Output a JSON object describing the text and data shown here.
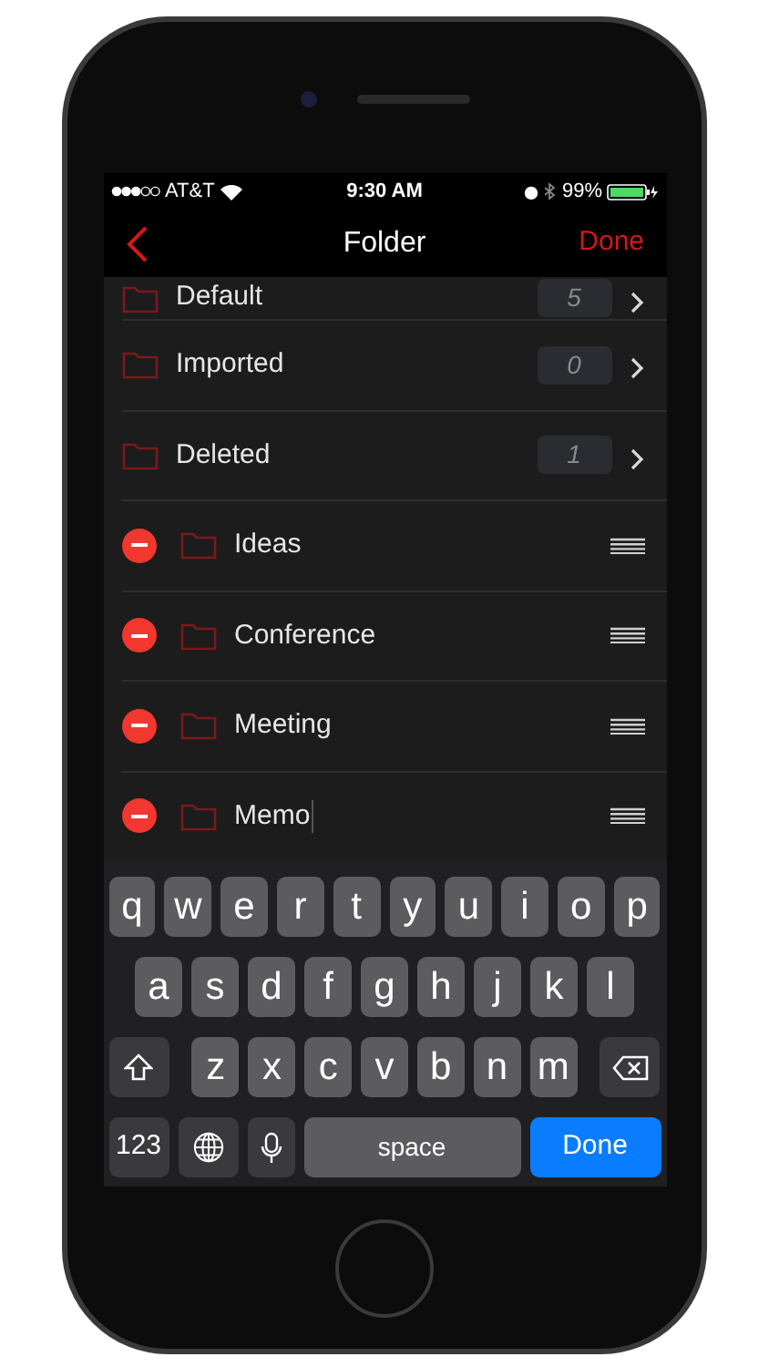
{
  "status_bar": {
    "carrier": "AT&T",
    "time": "9:30 AM",
    "battery": "99%"
  },
  "nav": {
    "title": "Folder",
    "action": "Done"
  },
  "folders": [
    {
      "kind": "fixed",
      "name": "Default",
      "count": "5",
      "cut": true
    },
    {
      "kind": "fixed",
      "name": "Imported",
      "count": "0",
      "cut": false
    },
    {
      "kind": "fixed",
      "name": "Deleted",
      "count": "1",
      "cut": false
    },
    {
      "kind": "editable",
      "name": "Ideas",
      "editing": false
    },
    {
      "kind": "editable",
      "name": "Conference",
      "editing": false
    },
    {
      "kind": "editable",
      "name": "Meeting",
      "editing": false
    },
    {
      "kind": "editable",
      "name": "Memo",
      "editing": true
    }
  ],
  "keyboard": {
    "row_1": [
      {
        "kind": "letter",
        "label": "q"
      },
      {
        "kind": "letter",
        "label": "w"
      },
      {
        "kind": "letter",
        "label": "e"
      },
      {
        "kind": "letter",
        "label": "r"
      },
      {
        "kind": "letter",
        "label": "t"
      },
      {
        "kind": "letter",
        "label": "y"
      },
      {
        "kind": "letter",
        "label": "u"
      },
      {
        "kind": "letter",
        "label": "i"
      },
      {
        "kind": "letter",
        "label": "o"
      },
      {
        "kind": "letter",
        "label": "p"
      }
    ],
    "row_2": [
      {
        "kind": "letter",
        "label": "a"
      },
      {
        "kind": "letter",
        "label": "s"
      },
      {
        "kind": "letter",
        "label": "d"
      },
      {
        "kind": "letter",
        "label": "f"
      },
      {
        "kind": "letter",
        "label": "g"
      },
      {
        "kind": "letter",
        "label": "h"
      },
      {
        "kind": "letter",
        "label": "j"
      },
      {
        "kind": "letter",
        "label": "k"
      },
      {
        "kind": "letter",
        "label": "l"
      }
    ],
    "row_3": [
      {
        "kind": "shift"
      },
      {
        "kind": "letter",
        "label": "z"
      },
      {
        "kind": "letter",
        "label": "x"
      },
      {
        "kind": "letter",
        "label": "c"
      },
      {
        "kind": "letter",
        "label": "v"
      },
      {
        "kind": "letter",
        "label": "b"
      },
      {
        "kind": "letter",
        "label": "n"
      },
      {
        "kind": "letter",
        "label": "m"
      },
      {
        "kind": "delete"
      }
    ],
    "row_4": [
      {
        "kind": "numbers",
        "label": "123"
      },
      {
        "kind": "globe"
      },
      {
        "kind": "mic"
      },
      {
        "kind": "space",
        "label": "space"
      },
      {
        "kind": "return",
        "label": "Done"
      }
    ]
  }
}
